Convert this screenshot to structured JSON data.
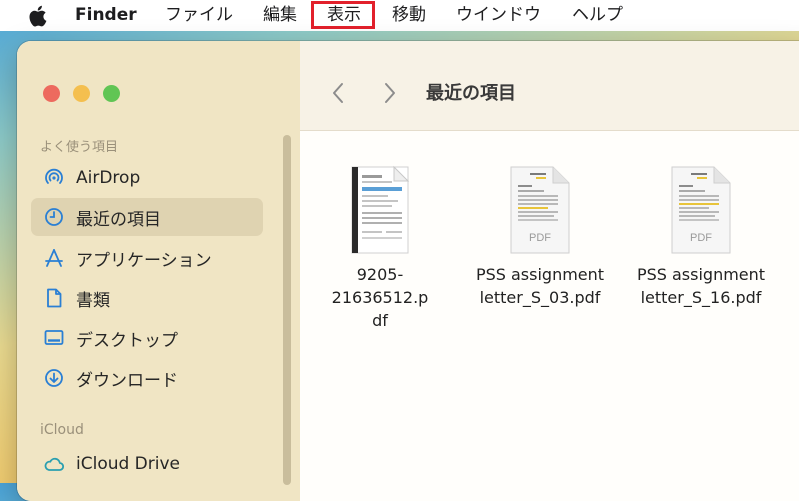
{
  "menubar": {
    "app_name": "Finder",
    "items": [
      "ファイル",
      "編集",
      "表示",
      "移動",
      "ウインドウ",
      "ヘルプ"
    ],
    "highlighted_item": "表示"
  },
  "window": {
    "title": "最近の項目",
    "colors": {
      "highlight_border": "#e2202b"
    }
  },
  "sidebar": {
    "sections": [
      {
        "heading": "よく使う項目",
        "items": [
          {
            "label": "AirDrop",
            "icon": "airdrop-icon",
            "selected": false
          },
          {
            "label": "最近の項目",
            "icon": "clock-icon",
            "selected": true
          },
          {
            "label": "アプリケーション",
            "icon": "applications-icon",
            "selected": false
          },
          {
            "label": "書類",
            "icon": "document-icon",
            "selected": false
          },
          {
            "label": "デスクトップ",
            "icon": "desktop-icon",
            "selected": false
          },
          {
            "label": "ダウンロード",
            "icon": "download-icon",
            "selected": false
          }
        ]
      },
      {
        "heading": "iCloud",
        "items": [
          {
            "label": "iCloud Drive",
            "icon": "cloud-icon",
            "selected": false
          }
        ]
      }
    ]
  },
  "files": [
    {
      "name": "9205-21636512.p\ndf",
      "icon": "invoice-pdf-thumbnail"
    },
    {
      "name": "PSS assignment\nletter_S_03.pdf",
      "icon": "pdf-document-icon",
      "badge": "PDF"
    },
    {
      "name": "PSS assignment\nletter_S_16.pdf",
      "icon": "pdf-document-icon",
      "badge": "PDF"
    }
  ]
}
